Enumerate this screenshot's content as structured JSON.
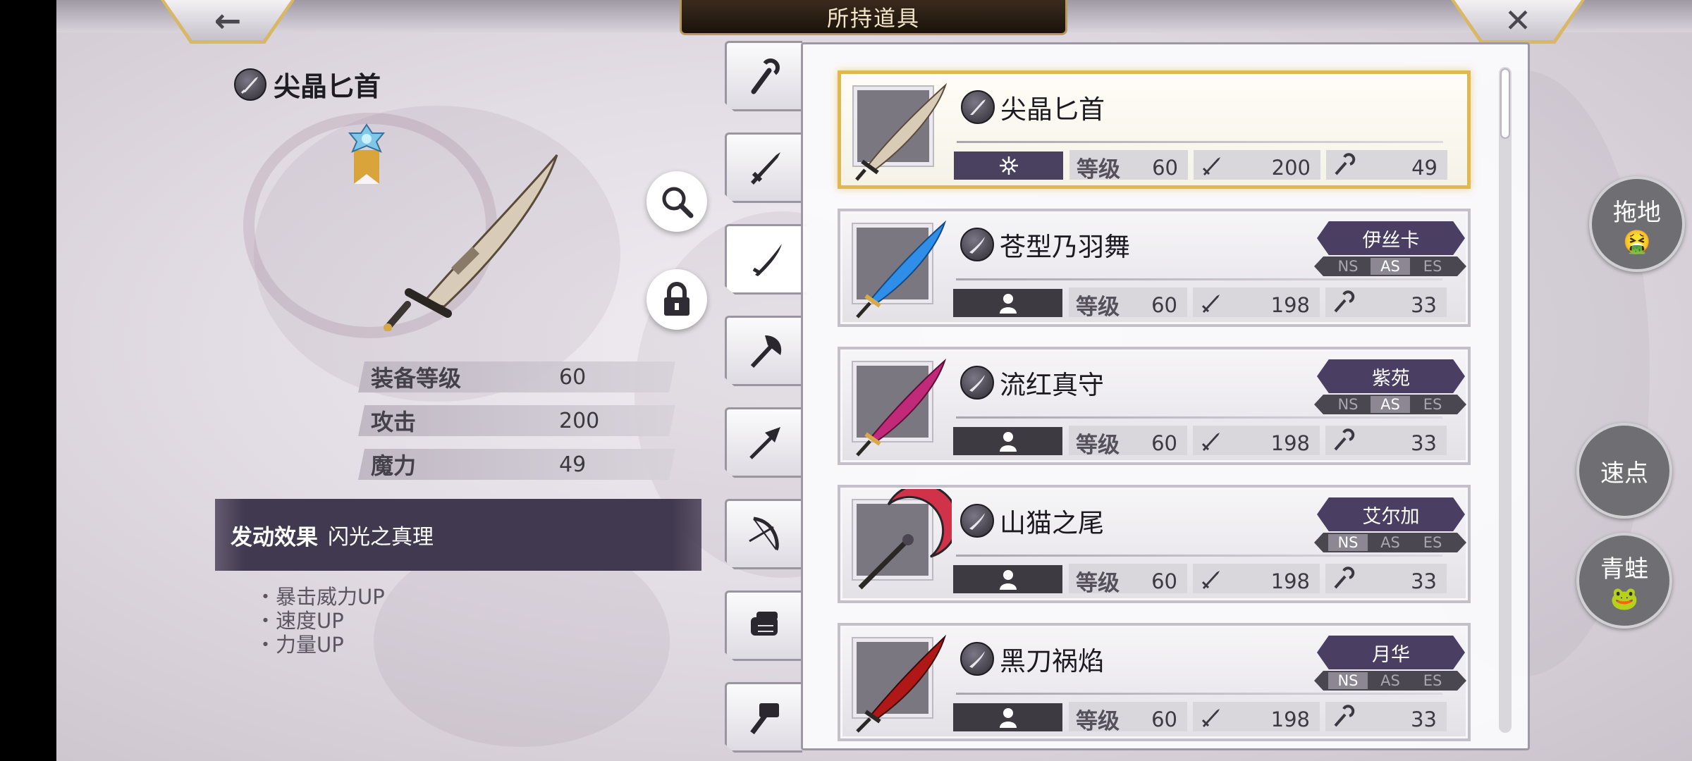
{
  "header": {
    "title": "所持道具",
    "back_glyph": "←",
    "close_glyph": "✕"
  },
  "detail": {
    "name": "尖晶匕首",
    "category_icon": "dagger-icon",
    "stats": [
      {
        "label": "装备等级",
        "value": "60"
      },
      {
        "label": "攻击",
        "value": "200"
      },
      {
        "label": "魔力",
        "value": "49"
      }
    ],
    "effect_key": "发动效果",
    "effect_name": "闪光之真理",
    "effect_list": [
      "・暴击威力UP",
      "・速度UP",
      "・力量UP"
    ]
  },
  "tabs": [
    "staff-icon",
    "sword-icon",
    "katana-icon",
    "axe-icon",
    "spear-icon",
    "bow-icon",
    "fist-icon",
    "hammer-icon"
  ],
  "active_tab": 2,
  "list_label_level": "等级",
  "items": [
    {
      "name": "尖晶匕首",
      "level": "60",
      "atk": "200",
      "mag": "49",
      "owner": "",
      "styles": [],
      "selected": true,
      "rarity": "awakened",
      "color": "#c9b79a"
    },
    {
      "name": "苍型乃羽舞",
      "level": "60",
      "atk": "198",
      "mag": "33",
      "owner": "伊丝卡",
      "styles": [
        "NS",
        "AS",
        "ES"
      ],
      "active_style": "AS",
      "selected": false,
      "rarity": "plain",
      "color": "#2f8fe8"
    },
    {
      "name": "流红真守",
      "level": "60",
      "atk": "198",
      "mag": "33",
      "owner": "紫苑",
      "styles": [
        "NS",
        "AS",
        "ES"
      ],
      "active_style": "AS",
      "selected": false,
      "rarity": "plain",
      "color": "#c02a78"
    },
    {
      "name": "山猫之尾",
      "level": "60",
      "atk": "198",
      "mag": "33",
      "owner": "艾尔加",
      "styles": [
        "NS",
        "AS",
        "ES"
      ],
      "active_style": "NS",
      "selected": false,
      "rarity": "plain",
      "color": "#d0324a"
    },
    {
      "name": "黑刀祸焰",
      "level": "60",
      "atk": "198",
      "mag": "33",
      "owner": "月华",
      "styles": [
        "NS",
        "AS",
        "ES"
      ],
      "active_style": "NS",
      "selected": false,
      "rarity": "plain",
      "color": "#b01818"
    }
  ],
  "float_buttons": [
    {
      "label": "拖地",
      "emoji": "🤮"
    },
    {
      "label": "速点",
      "emoji": ""
    },
    {
      "label": "青蛙",
      "emoji": "🐸"
    }
  ]
}
